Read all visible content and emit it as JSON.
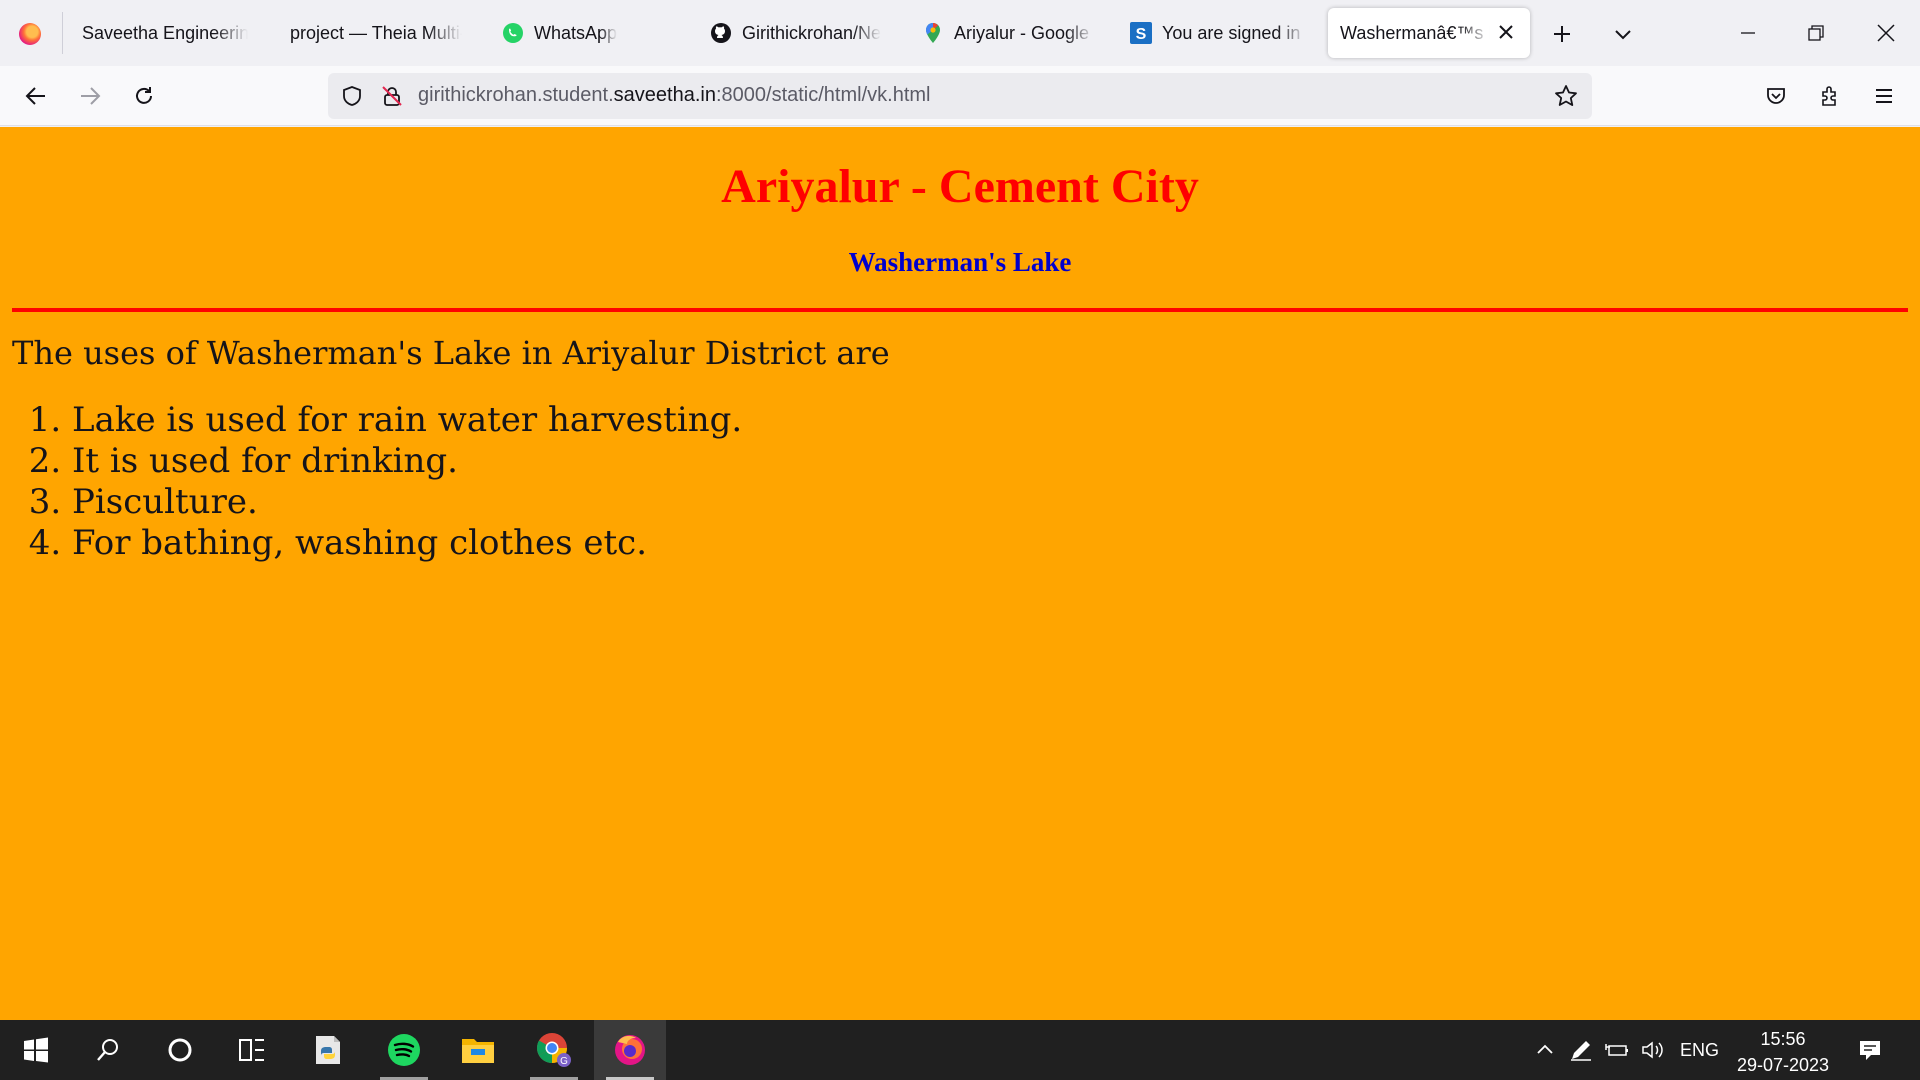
{
  "browser": {
    "tabs": [
      {
        "label": "Saveetha Engineering",
        "icon": "firefox-icon"
      },
      {
        "label": "project — Theia Multi-",
        "icon": "none"
      },
      {
        "label": "WhatsApp",
        "icon": "whatsapp-icon"
      },
      {
        "label": "Girithickrohan/Ne",
        "icon": "github-icon"
      },
      {
        "label": "Ariyalur - Google M",
        "icon": "google-maps-icon"
      },
      {
        "label": "You are signed in a",
        "icon": "saveetha-s-icon"
      },
      {
        "label": "Washermanâ€™s La",
        "icon": "none",
        "active": true
      }
    ],
    "url": {
      "prefix": "girithickrohan.student.",
      "host": "saveetha.in",
      "suffix": ":8000/static/html/vk.html"
    }
  },
  "page": {
    "title": "Ariyalur - Cement City",
    "subtitle": "Washerman's Lake",
    "intro": "The uses of Washerman's Lake in Ariyalur District are",
    "uses": [
      "Lake is used for rain water harvesting.",
      "It is used for drinking.",
      "Pisculture.",
      "For bathing, washing clothes etc."
    ],
    "colors": {
      "background": "#ffa500",
      "title": "#ff0000",
      "subtitle": "#0000cd",
      "rule": "#ff0000"
    }
  },
  "taskbar": {
    "apps": [
      "windows-start-icon",
      "search-icon",
      "cortana-icon",
      "task-view-icon",
      "python-notepad-icon",
      "spotify-icon",
      "file-explorer-icon",
      "chrome-icon",
      "firefox-icon"
    ],
    "language": "ENG",
    "time": "15:56",
    "date": "29-07-2023"
  }
}
